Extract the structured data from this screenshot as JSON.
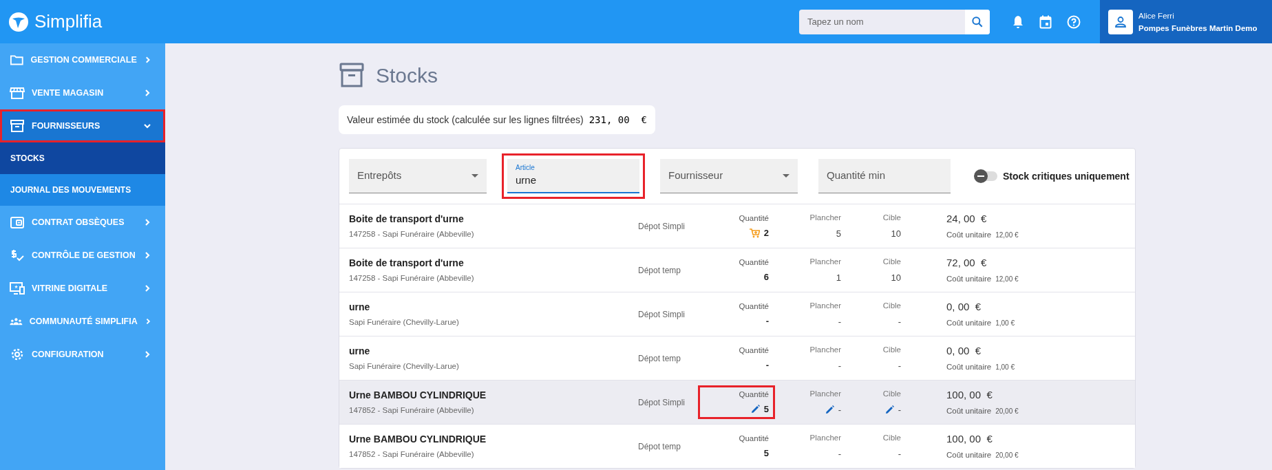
{
  "header": {
    "logo": "Simplifia",
    "search": {
      "placeholder": "Tapez un nom"
    },
    "user": {
      "name": "Alice Ferri",
      "company": "Pompes Funèbres Martin Demo"
    }
  },
  "sidebar": {
    "items": [
      {
        "kind": "folder",
        "label": "GESTION COMMERCIALE",
        "expanded": false,
        "highlighted": false
      },
      {
        "kind": "store",
        "label": "VENTE MAGASIN",
        "expanded": false,
        "highlighted": false
      },
      {
        "kind": "archive",
        "label": "FOURNISSEURS",
        "expanded": true,
        "highlighted": true,
        "children": [
          {
            "label": "STOCKS",
            "selected": true
          },
          {
            "label": "JOURNAL DES MOUVEMENTS",
            "selected": false
          }
        ]
      },
      {
        "kind": "wallet",
        "label": "CONTRAT OBSÈQUES",
        "expanded": false,
        "highlighted": false
      },
      {
        "kind": "money",
        "label": "CONTRÔLE DE GESTION",
        "expanded": false,
        "highlighted": false
      },
      {
        "kind": "monitor",
        "label": "VITRINE DIGITALE",
        "expanded": false,
        "highlighted": false
      },
      {
        "kind": "people",
        "label": "COMMUNAUTÉ SIMPLIFIA",
        "expanded": false,
        "highlighted": false
      },
      {
        "kind": "gear",
        "label": "CONFIGURATION",
        "expanded": false,
        "highlighted": false
      }
    ]
  },
  "page": {
    "title": "Stocks",
    "estimate": {
      "label": "Valeur estimée du stock (calculée sur les lignes filtrées)",
      "value": "231, 00  €"
    }
  },
  "filters": [
    {
      "kind": "select",
      "placeholder": "Entrepôts",
      "highlighted": false
    },
    {
      "kind": "text",
      "label": "Article",
      "value": "urne",
      "highlighted": true
    },
    {
      "kind": "select",
      "placeholder": "Fournisseur",
      "highlighted": false
    },
    {
      "kind": "text",
      "placeholder": "Quantité min",
      "highlighted": false
    },
    {
      "kind": "toggle",
      "label": "Stock critiques uniquement",
      "on": false
    }
  ],
  "rows": [
    {
      "name": "Boite de transport d'urne",
      "supplier": "147258 - Sapi Funéraire (Abbeville)",
      "depot": "Dépot Simpli",
      "qty_label": "Quantité",
      "qty": "2",
      "restock_alert": true,
      "qty_highlighted": false,
      "floor_label": "Plancher",
      "floor": "5",
      "target_label": "Cible",
      "target": "10",
      "editable": false,
      "hovered": false,
      "total": "24, 00  €",
      "unit_label": "Coût unitaire",
      "unit": "12,00 €"
    },
    {
      "name": "Boite de transport d'urne",
      "supplier": "147258 - Sapi Funéraire (Abbeville)",
      "depot": "Dépot temp",
      "qty_label": "Quantité",
      "qty": "6",
      "restock_alert": false,
      "qty_highlighted": false,
      "floor_label": "Plancher",
      "floor": "1",
      "target_label": "Cible",
      "target": "10",
      "editable": false,
      "hovered": false,
      "total": "72, 00  €",
      "unit_label": "Coût unitaire",
      "unit": "12,00 €"
    },
    {
      "name": "urne",
      "supplier": "Sapi Funéraire (Chevilly-Larue)",
      "depot": "Dépot Simpli",
      "qty_label": "Quantité",
      "qty": "-",
      "restock_alert": false,
      "qty_highlighted": false,
      "floor_label": "Plancher",
      "floor": "-",
      "target_label": "Cible",
      "target": "-",
      "editable": false,
      "hovered": false,
      "total": "0, 00  €",
      "unit_label": "Coût unitaire",
      "unit": "1,00 €"
    },
    {
      "name": "urne",
      "supplier": "Sapi Funéraire (Chevilly-Larue)",
      "depot": "Dépot temp",
      "qty_label": "Quantité",
      "qty": "-",
      "restock_alert": false,
      "qty_highlighted": false,
      "floor_label": "Plancher",
      "floor": "-",
      "target_label": "Cible",
      "target": "-",
      "editable": false,
      "hovered": false,
      "total": "0, 00  €",
      "unit_label": "Coût unitaire",
      "unit": "1,00 €"
    },
    {
      "name": "Urne BAMBOU CYLINDRIQUE",
      "supplier": "147852 - Sapi Funéraire (Abbeville)",
      "depot": "Dépot Simpli",
      "qty_label": "Quantité",
      "qty": "5",
      "restock_alert": false,
      "qty_highlighted": true,
      "floor_label": "Plancher",
      "floor": "-",
      "target_label": "Cible",
      "target": "-",
      "editable": true,
      "hovered": true,
      "total": "100, 00  €",
      "unit_label": "Coût unitaire",
      "unit": "20,00 €"
    },
    {
      "name": "Urne BAMBOU CYLINDRIQUE",
      "supplier": "147852 - Sapi Funéraire (Abbeville)",
      "depot": "Dépot temp",
      "qty_label": "Quantité",
      "qty": "5",
      "restock_alert": false,
      "qty_highlighted": false,
      "floor_label": "Plancher",
      "floor": "-",
      "target_label": "Cible",
      "target": "-",
      "editable": false,
      "hovered": false,
      "total": "100, 00  €",
      "unit_label": "Coût unitaire",
      "unit": "20,00 €"
    }
  ]
}
